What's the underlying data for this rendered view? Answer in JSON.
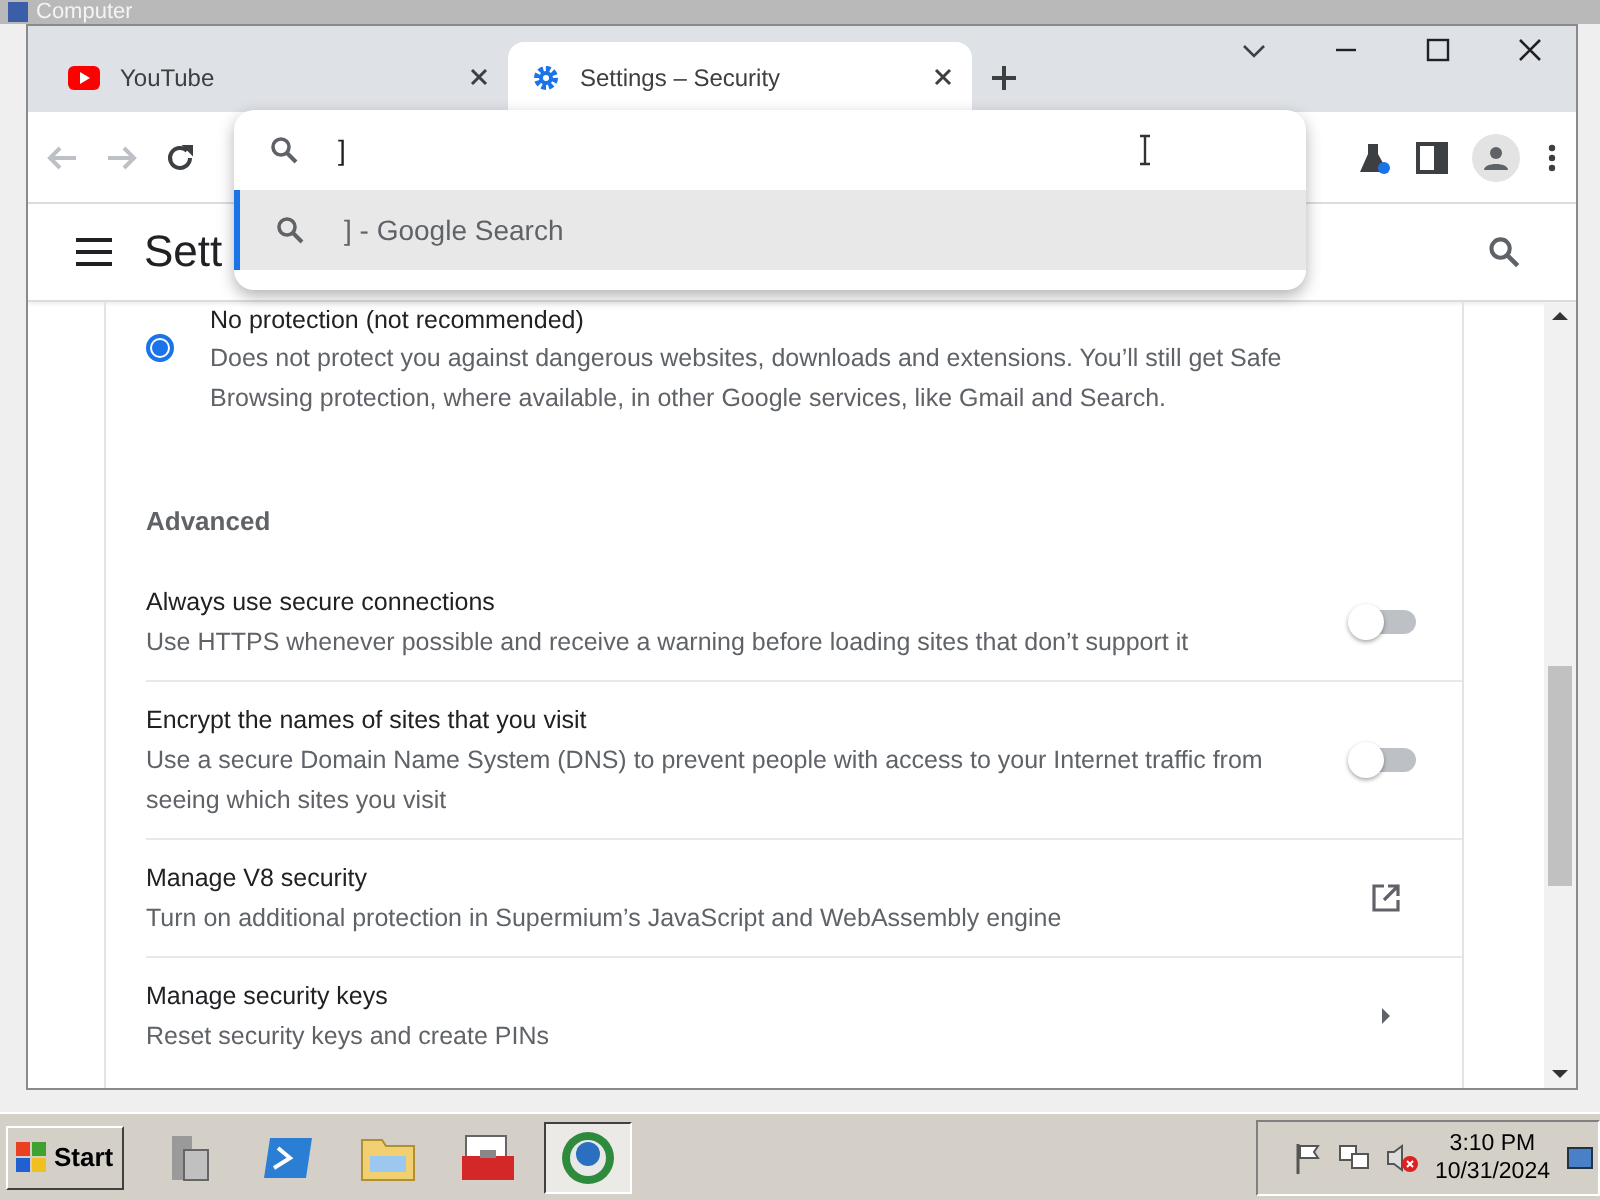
{
  "desktop": {
    "icon_label": "Computer"
  },
  "browser": {
    "tabs": [
      {
        "title": "YouTube",
        "selected": false
      },
      {
        "title": "Settings – Security",
        "selected": true
      }
    ],
    "omnibox": {
      "value": "]",
      "suggestions": [
        {
          "text": "] - Google Search",
          "selected": true
        }
      ]
    },
    "settings": {
      "title": "Sett",
      "protection_option": {
        "label": "No protection (not recommended)",
        "description": "Does not protect you against dangerous websites, downloads and extensions. You’ll still get Safe Browsing protection, where available, in other Google services, like Gmail and Search.",
        "selected": true
      },
      "section_title": "Advanced",
      "rows": [
        {
          "kind": "toggle",
          "title": "Always use secure connections",
          "description": "Use HTTPS whenever possible and receive a warning before loading sites that don’t support it",
          "on": false
        },
        {
          "kind": "toggle",
          "title": "Encrypt the names of sites that you visit",
          "description": "Use a secure Domain Name System (DNS) to prevent people with access to your Internet traffic from seeing which sites you visit",
          "on": false
        },
        {
          "kind": "external",
          "title": "Manage V8 security",
          "description": "Turn on additional protection in Supermium’s JavaScript and WebAssembly engine"
        },
        {
          "kind": "arrow",
          "title": "Manage security keys",
          "description": "Reset security keys and create PINs"
        }
      ]
    }
  },
  "taskbar": {
    "start": "Start",
    "apps": [
      {
        "kind": "server",
        "selected": false
      },
      {
        "kind": "powershell",
        "selected": false
      },
      {
        "kind": "folder",
        "selected": false
      },
      {
        "kind": "toolbox",
        "selected": false
      },
      {
        "kind": "browser",
        "selected": true
      }
    ],
    "time": "3:10 PM",
    "date": "10/31/2024"
  }
}
